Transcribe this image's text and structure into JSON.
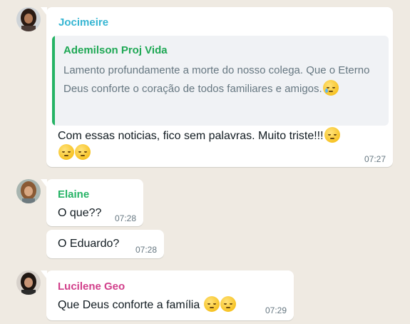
{
  "colors": {
    "background": "#efeae2",
    "bubble": "#ffffff",
    "jocimeire_name": "#35b5d2",
    "ademilson_name": "#1fa855",
    "elaine_name": "#25b365",
    "lucilene_name": "#d13e8a",
    "quote_bar": "#25b365"
  },
  "messages": {
    "jocimeire": {
      "sender": "Jocimeire",
      "quote": {
        "author": "Ademilson Proj Vida",
        "text": "Lamento profundamente a morte do nosso colega. Que o Eterno Deus conforte o coração de todos familiares e amigos.",
        "emoji": "crying-face-icon"
      },
      "text_line1": "Com essas noticias, fico sem palavras. Muito triste!!!",
      "emojis": [
        "pensive-face-icon",
        "pensive-face-icon",
        "pensive-face-icon"
      ],
      "time": "07:27"
    },
    "elaine": {
      "sender": "Elaine",
      "text1": "O que??",
      "time1": "07:28",
      "text2": "O Eduardo?",
      "time2": "07:28"
    },
    "lucilene": {
      "sender": "Lucilene Geo",
      "text": "Que Deus conforte a família",
      "emojis": [
        "pensive-face-icon",
        "pensive-face-icon"
      ],
      "time": "07:29"
    }
  }
}
